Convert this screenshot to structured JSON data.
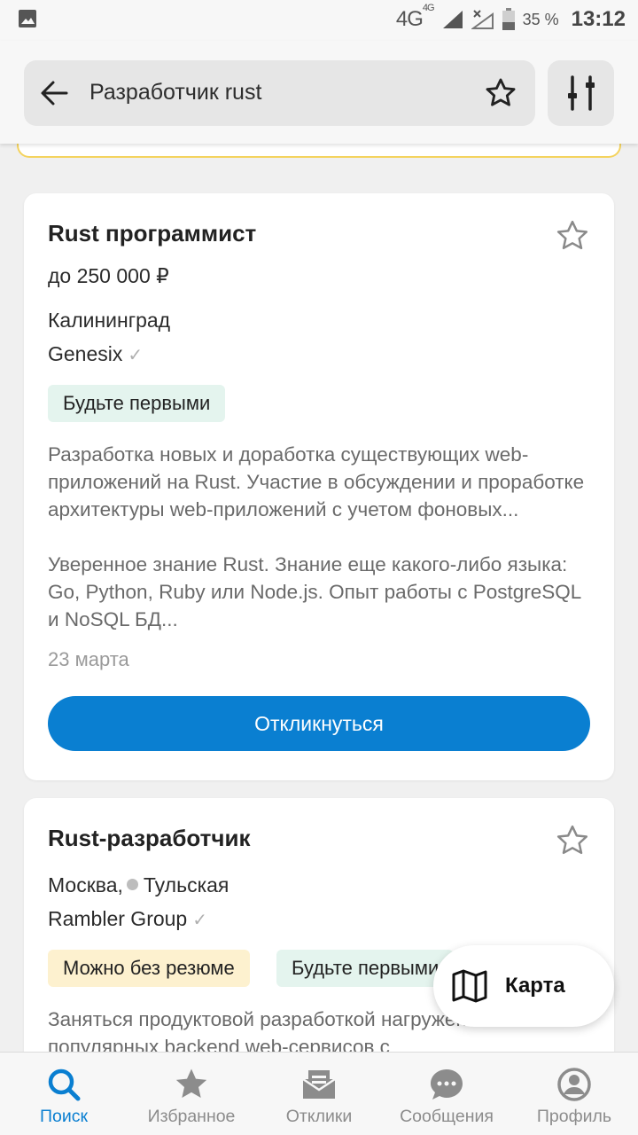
{
  "status_bar": {
    "network": "4G",
    "network_small": "4G",
    "battery": "35 %",
    "time": "13:12"
  },
  "search": {
    "query": "Разработчик rust"
  },
  "vacancies": [
    {
      "title": "Rust программист",
      "salary": "до 250 000 ₽",
      "city": "Калининград",
      "company": "Genesix",
      "badges": [
        "Будьте первыми"
      ],
      "description": "Разработка новых и доработка существующих web-приложений на Rust. Участие в обсуждении и проработке архитектуры web-приложений с учетом фоновых...",
      "requirements": "Уверенное знание Rust. Знание еще какого-либо языка: Go, Python, Ruby или Node.js. Опыт работы с PostgreSQL и NoSQL БД...",
      "date": "23 марта",
      "apply_label": "Откликнуться"
    },
    {
      "title": "Rust-разработчик",
      "city": "Москва,",
      "metro": "Тульская",
      "company": "Rambler Group",
      "badges": [
        "Можно без резюме",
        "Будьте первыми"
      ],
      "description": "Заняться продуктовой разработкой нагруженных и популярных backend web-сервисов с"
    }
  ],
  "map_button": {
    "label": "Карта"
  },
  "bottom_nav": [
    {
      "label": "Поиск",
      "icon": "search-icon",
      "active": true
    },
    {
      "label": "Избранное",
      "icon": "star-icon",
      "active": false
    },
    {
      "label": "Отклики",
      "icon": "inbox-icon",
      "active": false
    },
    {
      "label": "Сообщения",
      "icon": "chat-icon",
      "active": false
    },
    {
      "label": "Профиль",
      "icon": "profile-icon",
      "active": false
    }
  ],
  "colors": {
    "accent": "#0a7fd1",
    "badge_green": "#e4f4ee",
    "badge_yellow": "#fdf1cf",
    "inactive_icon": "#8c8c8c"
  }
}
